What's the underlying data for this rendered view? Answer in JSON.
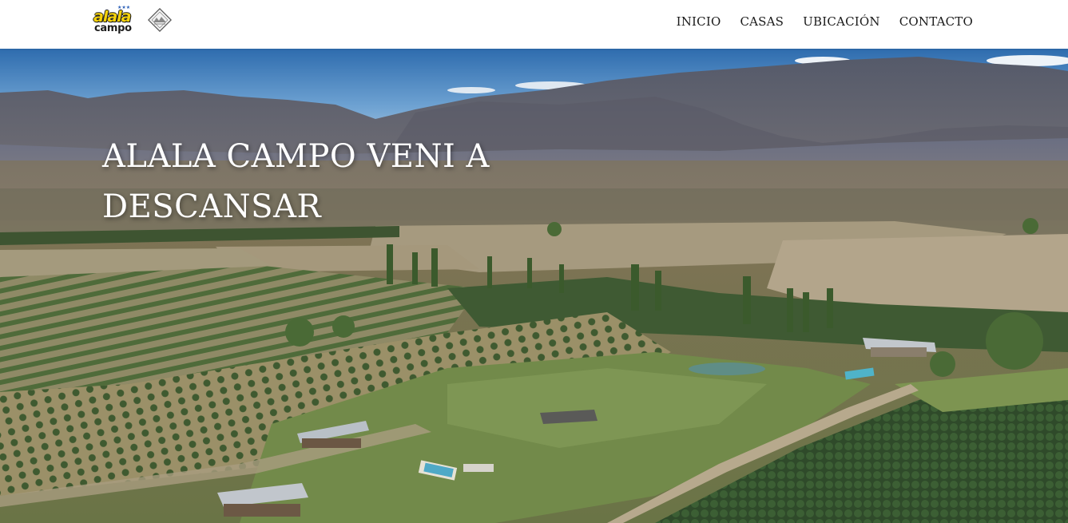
{
  "site": {
    "logo": {
      "word_top": "alala",
      "word_bottom": "campo",
      "badge_icon": "diamond-badge-icon"
    },
    "nav": [
      {
        "label": "INICIO"
      },
      {
        "label": "CASAS"
      },
      {
        "label": "UBICACIÓN"
      },
      {
        "label": "CONTACTO"
      }
    ]
  },
  "hero": {
    "title": "ALALA CAMPO VENI A DESCANSAR",
    "background": "aerial-valley-farm-image"
  },
  "colors": {
    "header_bg": "#ffffff",
    "nav_text": "#1a1a1a",
    "logo_yellow": "#f5d20b",
    "hero_title": "#ffffff"
  }
}
